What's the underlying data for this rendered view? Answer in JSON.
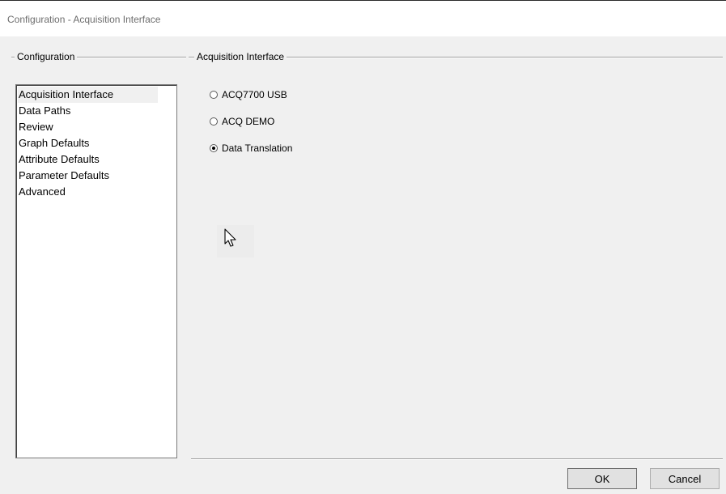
{
  "window": {
    "title": "Configuration - Acquisition Interface"
  },
  "config_group": {
    "label": "Configuration"
  },
  "nav": {
    "items": [
      {
        "label": "Acquisition Interface",
        "selected": true
      },
      {
        "label": "Data Paths",
        "selected": false
      },
      {
        "label": "Review",
        "selected": false
      },
      {
        "label": "Graph Defaults",
        "selected": false
      },
      {
        "label": "Attribute Defaults",
        "selected": false
      },
      {
        "label": "Parameter Defaults",
        "selected": false
      },
      {
        "label": "Advanced",
        "selected": false
      }
    ]
  },
  "acq_group": {
    "label": "Acquisition Interface",
    "options": [
      {
        "label": "ACQ7700 USB",
        "checked": false
      },
      {
        "label": "ACQ DEMO",
        "checked": false
      },
      {
        "label": "Data Translation",
        "checked": true
      }
    ]
  },
  "buttons": {
    "ok": "OK",
    "cancel": "Cancel"
  },
  "icons": {
    "cursor": "mouse-pointer-icon"
  },
  "colors": {
    "background": "#f0f0f0",
    "title_text": "#6d6d6d",
    "selected_item": "#f0f0f0"
  }
}
